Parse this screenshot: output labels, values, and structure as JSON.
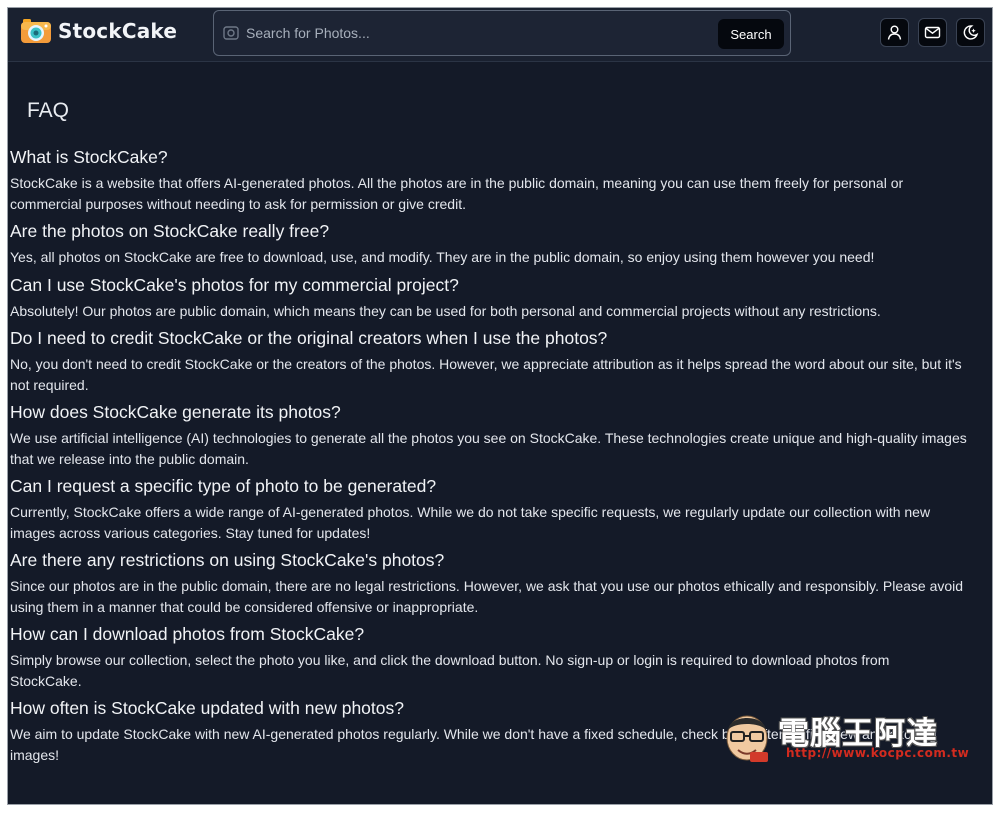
{
  "header": {
    "logo_text": "StockCake",
    "search": {
      "placeholder": "Search for Photos...",
      "value": "",
      "button_label": "Search"
    },
    "icons": [
      "user-icon",
      "mail-icon",
      "theme-toggle-icon"
    ]
  },
  "main": {
    "title": "FAQ",
    "faqs": [
      {
        "q": "What is StockCake?",
        "a1": "StockCake is a website that offers AI-generated photos. All the photos are in the public domain, meaning you can use them freely for personal or",
        "a2": "commercial purposes without needing to ask for permission or give credit."
      },
      {
        "q": "Are the photos on StockCake really free?",
        "a1": "Yes, all photos on StockCake are free to download, use, and modify. They are in the public domain, so enjoy using them however you need!",
        "a2": ""
      },
      {
        "q": "Can I use StockCake's photos for my commercial project?",
        "a1": "Absolutely! Our photos are public domain, which means they can be used for both personal and commercial projects without any restrictions.",
        "a2": ""
      },
      {
        "q": "Do I need to credit StockCake or the original creators when I use the photos?",
        "a1": "No, you don't need to credit StockCake or the creators of the photos. However, we appreciate attribution as it helps spread the word about our site, but it's",
        "a2": "not required."
      },
      {
        "q": "How does StockCake generate its photos?",
        "a1": "We use artificial intelligence (AI) technologies to generate all the photos you see on StockCake. These technologies create unique and high-quality images",
        "a2": "that we release into the public domain."
      },
      {
        "q": "Can I request a specific type of photo to be generated?",
        "a1": "Currently, StockCake offers a wide range of AI-generated photos. While we do not take specific requests, we regularly update our collection with new",
        "a2": "images across various categories. Stay tuned for updates!"
      },
      {
        "q": "Are there any restrictions on using StockCake's photos?",
        "a1": "Since our photos are in the public domain, there are no legal restrictions. However, we ask that you use our photos ethically and responsibly. Please avoid",
        "a2": "using them in a manner that could be considered offensive or inappropriate."
      },
      {
        "q": "How can I download photos from StockCake?",
        "a1": "Simply browse our collection, select the photo you like, and click the download button. No sign-up or login is required to download photos from",
        "a2": "StockCake."
      },
      {
        "q": "How often is StockCake updated with new photos?",
        "a1": "We aim to update StockCake with new AI-generated photos regularly. While we don't have a fixed schedule, check back often to find new and exciting",
        "a2": "images!"
      }
    ]
  },
  "watermark": {
    "name": "電腦王阿達",
    "url": "http://www.kocpc.com.tw"
  }
}
